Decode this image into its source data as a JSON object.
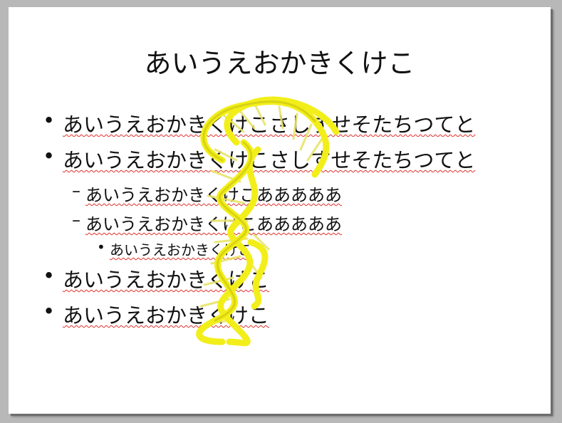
{
  "slide": {
    "title": "あいうえおかきくけこ",
    "bullets": [
      {
        "level": 1,
        "marker": "•",
        "text": "あいうえおかきくけこさしすせそたちつてと"
      },
      {
        "level": 1,
        "marker": "•",
        "text": "あいうえおかきくけこさしすせそたちつてと"
      },
      {
        "level": 2,
        "marker": "–",
        "text": "あいうえおかきくけこあああああ"
      },
      {
        "level": 2,
        "marker": "–",
        "text": "あいうえおかきくけこあああああ"
      },
      {
        "level": 3,
        "marker": "•",
        "text": "あいうえおかきくけこ"
      },
      {
        "level": 1,
        "marker": "•",
        "text": "あいうえおかきくけこ"
      },
      {
        "level": 1,
        "marker": "•",
        "text": "あいうえおかきくけこ"
      }
    ]
  },
  "image": {
    "name": "rna-helix-3d-model",
    "color": "#f2ee1a"
  },
  "colors": {
    "background": "#b8b8b8",
    "slide": "#ffffff",
    "spellcheck": "#e0302a",
    "text": "#111111"
  }
}
